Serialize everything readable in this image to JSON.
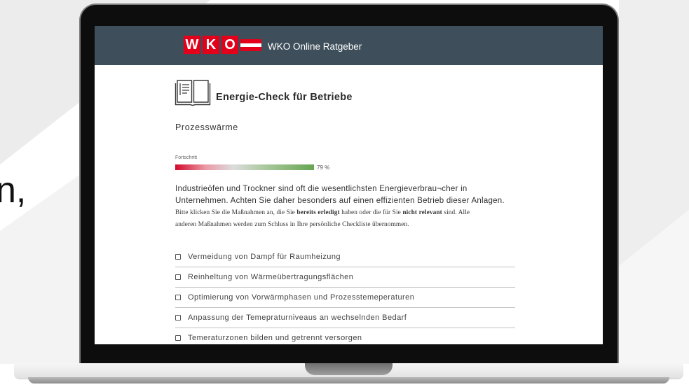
{
  "background_text": "n,",
  "header": {
    "logo_letters": [
      "W",
      "K",
      "O"
    ],
    "title": "WKO Online Ratgeber"
  },
  "page": {
    "title": "Energie-Check für Betriebe",
    "section": "Prozesswärme",
    "progress": {
      "label": "Fortschritt",
      "value": 79,
      "value_text": "79 %"
    },
    "intro": {
      "line1": "Industrieöfen und Trockner sind oft die wesentlichsten Energieverbrau¬cher in",
      "line2": "Unternehmen. Achten Sie daher besonders auf einen effizienten Betrieb dieser Anlagen."
    },
    "instructions": {
      "text_1": "Bitte klicken Sie die Maßnahmen an, die Sie ",
      "bold_1": "bereits erledigt",
      "text_2": " haben oder die für Sie ",
      "bold_2": "nicht relevant",
      "text_3": " sind. Alle",
      "line2": "anderen Maßnahmen werden zum Schluss in Ihre persönliche Checkliste übernommen."
    },
    "measures": [
      {
        "label": "Vermeidung von Dampf für Raumheizung",
        "checked": false
      },
      {
        "label": "Reinheltung von Wärmeübertragungsflächen",
        "checked": false
      },
      {
        "label": "Optimierung von Vorwärmphasen und Prozesstemeperaturen",
        "checked": false
      },
      {
        "label": "Anpassung der Temepraturniveaus an wechselnden Bedarf",
        "checked": false
      },
      {
        "label": "Temeraturzonen bilden und getrennt versorgen",
        "checked": false
      }
    ]
  },
  "icons": {
    "section_icon": "book-icon",
    "measure_checkbox": "checkbox-icon",
    "logo_flag": "flag-icon"
  },
  "colors": {
    "header_bg": "#3e4f5b",
    "brand_red": "#e2001a",
    "text": "#333333",
    "progress_start": "#d30a2c",
    "progress_mid": "#dcdcdc",
    "progress_end": "#66a552"
  }
}
